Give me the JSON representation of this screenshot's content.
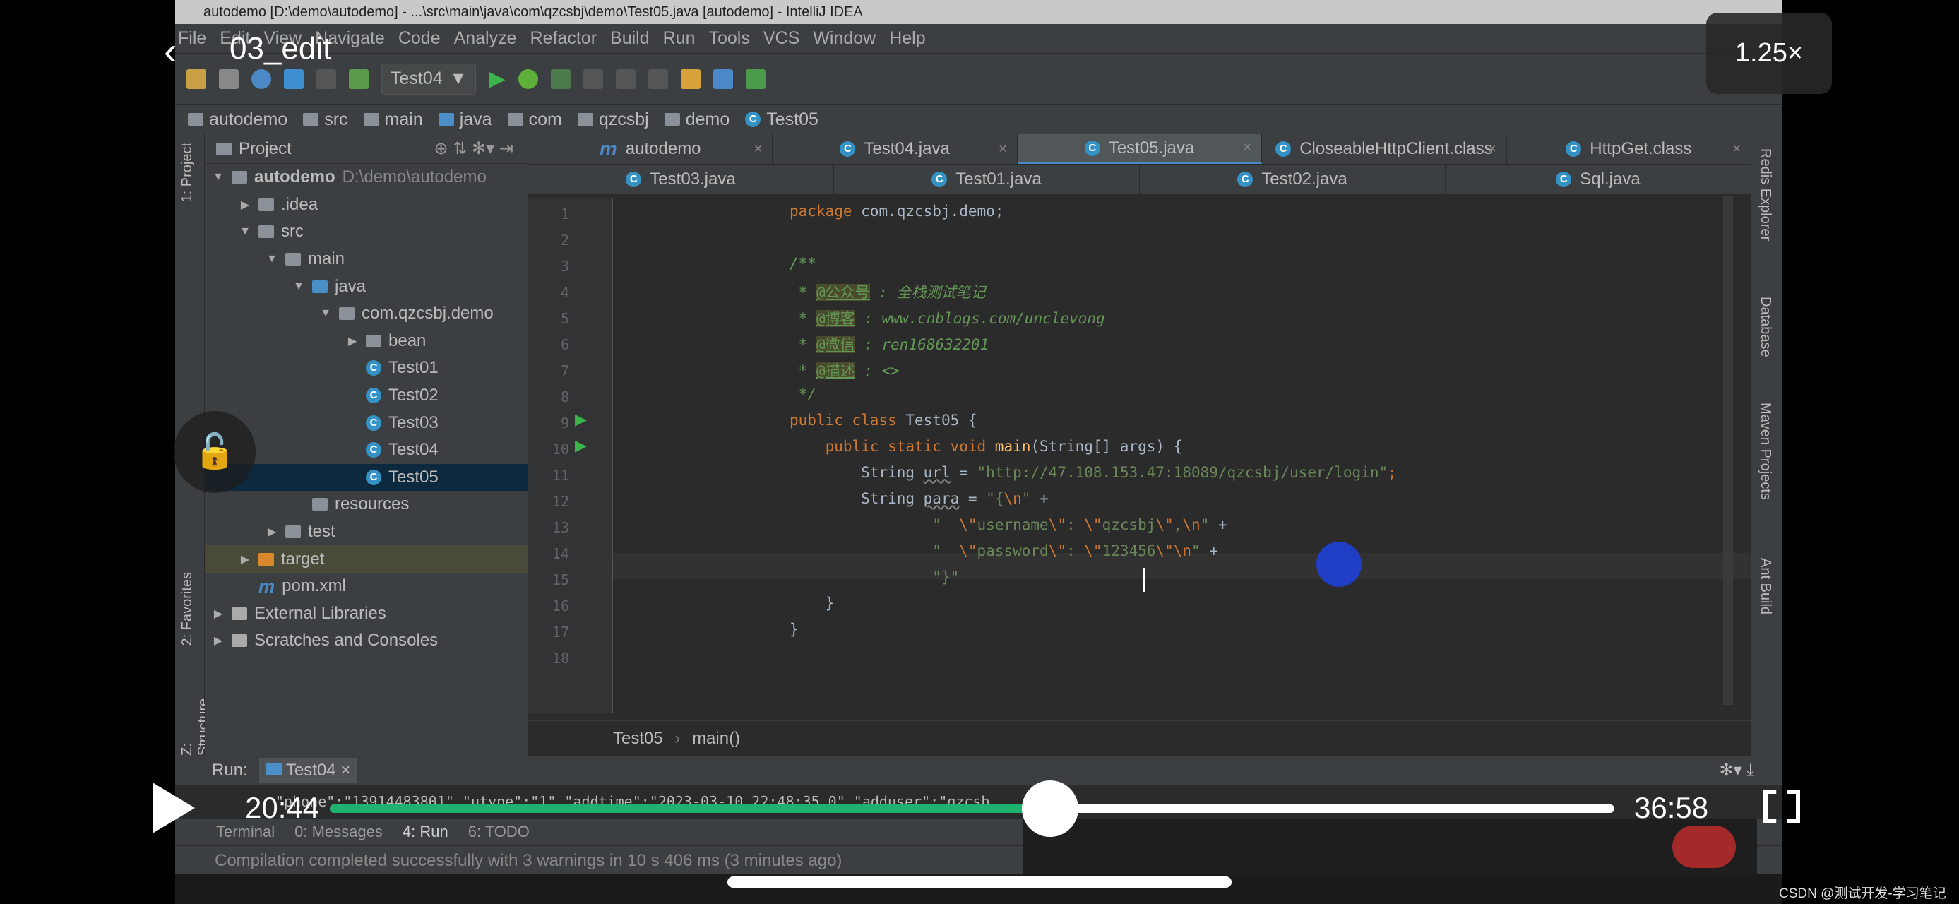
{
  "window_title": "autodemo [D:\\demo\\autodemo] - ...\\src\\main\\java\\com\\qzcsbj\\demo\\Test05.java [autodemo] - IntelliJ IDEA",
  "menu": [
    "File",
    "Edit",
    "View",
    "Navigate",
    "Code",
    "Analyze",
    "Refactor",
    "Build",
    "Run",
    "Tools",
    "VCS",
    "Window",
    "Help"
  ],
  "toolbar": {
    "run_config": "Test04"
  },
  "breadcrumb": [
    "autodemo",
    "src",
    "main",
    "java",
    "com",
    "qzcsbj",
    "demo",
    "Test05"
  ],
  "left_strip": {
    "project": "1: Project",
    "favorites": "2: Favorites",
    "structure": "Z: Structure"
  },
  "project_panel": {
    "title": "Project",
    "tree": [
      {
        "label": "autodemo",
        "extra": "D:\\demo\\autodemo",
        "level": 0,
        "arrow": "▼",
        "icon": "module-folder",
        "bold": true
      },
      {
        "label": ".idea",
        "level": 1,
        "arrow": "▶",
        "icon": "folder"
      },
      {
        "label": "src",
        "level": 1,
        "arrow": "▼",
        "icon": "folder"
      },
      {
        "label": "main",
        "level": 2,
        "arrow": "▼",
        "icon": "folder"
      },
      {
        "label": "java",
        "level": 3,
        "arrow": "▼",
        "icon": "source-folder"
      },
      {
        "label": "com.qzcsbj.demo",
        "level": 4,
        "arrow": "▼",
        "icon": "package"
      },
      {
        "label": "bean",
        "level": 5,
        "arrow": "▶",
        "icon": "package"
      },
      {
        "label": "Test01",
        "level": 5,
        "arrow": "",
        "icon": "class"
      },
      {
        "label": "Test02",
        "level": 5,
        "arrow": "",
        "icon": "class"
      },
      {
        "label": "Test03",
        "level": 5,
        "arrow": "",
        "icon": "class"
      },
      {
        "label": "Test04",
        "level": 5,
        "arrow": "",
        "icon": "class"
      },
      {
        "label": "Test05",
        "level": 5,
        "arrow": "",
        "icon": "class",
        "selected": true
      },
      {
        "label": "resources",
        "level": 3,
        "arrow": "",
        "icon": "folder"
      },
      {
        "label": "test",
        "level": 2,
        "arrow": "▶",
        "icon": "folder"
      },
      {
        "label": "target",
        "level": 1,
        "arrow": "▶",
        "icon": "excluded-folder",
        "highlight": true
      },
      {
        "label": "pom.xml",
        "level": 1,
        "arrow": "",
        "icon": "maven"
      },
      {
        "label": "External Libraries",
        "level": 0,
        "arrow": "▶",
        "icon": "libraries"
      },
      {
        "label": "Scratches and Consoles",
        "level": 0,
        "arrow": "▶",
        "icon": "scratches"
      }
    ]
  },
  "editor": {
    "tabs_row1": [
      {
        "label": "autodemo",
        "icon": "maven"
      },
      {
        "label": "Test04.java",
        "icon": "class"
      },
      {
        "label": "Test05.java",
        "icon": "class",
        "active": true
      },
      {
        "label": "CloseableHttpClient.class",
        "icon": "class"
      },
      {
        "label": "HttpGet.class",
        "icon": "class"
      }
    ],
    "tabs_row2": [
      {
        "label": "Test03.java"
      },
      {
        "label": "Test01.java"
      },
      {
        "label": "Test02.java"
      },
      {
        "label": "Sql.java"
      }
    ],
    "lines": [
      [
        [
          "package",
          "kw"
        ],
        [
          " com.qzcsbj.demo;",
          ""
        ]
      ],
      [],
      [
        [
          "/**",
          "cm"
        ]
      ],
      [
        [
          " * ",
          "cm"
        ],
        [
          "@公众号",
          "tag"
        ],
        [
          " : 全栈测试笔记",
          "cm"
        ]
      ],
      [
        [
          " * ",
          "cm"
        ],
        [
          "@博客",
          "tag"
        ],
        [
          " : www.cnblogs.com/unclevong",
          "cm"
        ]
      ],
      [
        [
          " * ",
          "cm"
        ],
        [
          "@微信",
          "tag"
        ],
        [
          " : ren168632201",
          "cm"
        ]
      ],
      [
        [
          " * ",
          "cm"
        ],
        [
          "@描述",
          "tag"
        ],
        [
          " : <>",
          "cm"
        ]
      ],
      [
        [
          " */",
          "cm"
        ]
      ],
      [
        [
          "public class ",
          "kw"
        ],
        [
          "Test05 {",
          ""
        ]
      ],
      [
        [
          "    public static void ",
          "kw"
        ],
        [
          "main",
          "fn"
        ],
        [
          "(String[] args) {",
          ""
        ]
      ],
      [
        [
          "        String ",
          ""
        ],
        [
          "url",
          "ul"
        ],
        [
          " = ",
          ""
        ],
        [
          "\"http://47.108.153.47:18089/qzcsbj/user/login\"",
          "str"
        ],
        [
          ";",
          "kw"
        ]
      ],
      [
        [
          "        String ",
          ""
        ],
        [
          "para",
          "ul"
        ],
        [
          " = ",
          ""
        ],
        [
          "\"{",
          "str"
        ],
        [
          "\\n",
          "esc"
        ],
        [
          "\"",
          "str"
        ],
        [
          " +",
          ""
        ]
      ],
      [
        [
          "                ",
          ""
        ],
        [
          "\"  ",
          "str"
        ],
        [
          "\\\"",
          "esc"
        ],
        [
          "username",
          "str"
        ],
        [
          "\\\"",
          "esc"
        ],
        [
          ": ",
          "str"
        ],
        [
          "\\\"",
          "esc"
        ],
        [
          "qzcsbj",
          "str"
        ],
        [
          "\\\"",
          "esc"
        ],
        [
          ",",
          "str"
        ],
        [
          "\\n",
          "esc"
        ],
        [
          "\"",
          "str"
        ],
        [
          " +",
          ""
        ]
      ],
      [
        [
          "                ",
          ""
        ],
        [
          "\"  ",
          "str"
        ],
        [
          "\\\"",
          "esc"
        ],
        [
          "password",
          "str"
        ],
        [
          "\\\"",
          "esc"
        ],
        [
          ": ",
          "str"
        ],
        [
          "\\\"",
          "esc"
        ],
        [
          "123456",
          "str"
        ],
        [
          "\\\"",
          "esc"
        ],
        [
          "\\n",
          "esc"
        ],
        [
          "\"",
          "str"
        ],
        [
          " +",
          ""
        ]
      ],
      [
        [
          "                ",
          ""
        ],
        [
          "\"}\"",
          "str"
        ]
      ],
      [
        [
          "    }",
          ""
        ]
      ],
      [
        [
          "}",
          ""
        ]
      ],
      []
    ],
    "bottom_breadcrumb": [
      "Test05",
      "main()"
    ]
  },
  "right_strip": [
    "Redis Explorer",
    "Database",
    "Maven Projects",
    "Ant Build"
  ],
  "run_panel": {
    "label": "Run:",
    "config": "Test04",
    "console_line": "\"phone\":\"13914483801\",\"utype\":\"1\",\"addtime\":\"2023-03-10 22:48:35.0\",\"adduser\":\"qzcsb"
  },
  "bottom_tabs": [
    "Terminal",
    "0: Messages",
    "4: Run",
    "6: TODO"
  ],
  "status": "Compilation completed successfully with 3 warnings in 10 s 406 ms (3 minutes ago)",
  "video_player": {
    "title": "03_edit",
    "speed": "1.25×",
    "current_time": "20:44",
    "duration": "36:58",
    "progress": 0.561,
    "accent": "#1db36f"
  },
  "watermark": "CSDN @测试开发-学习笔记"
}
